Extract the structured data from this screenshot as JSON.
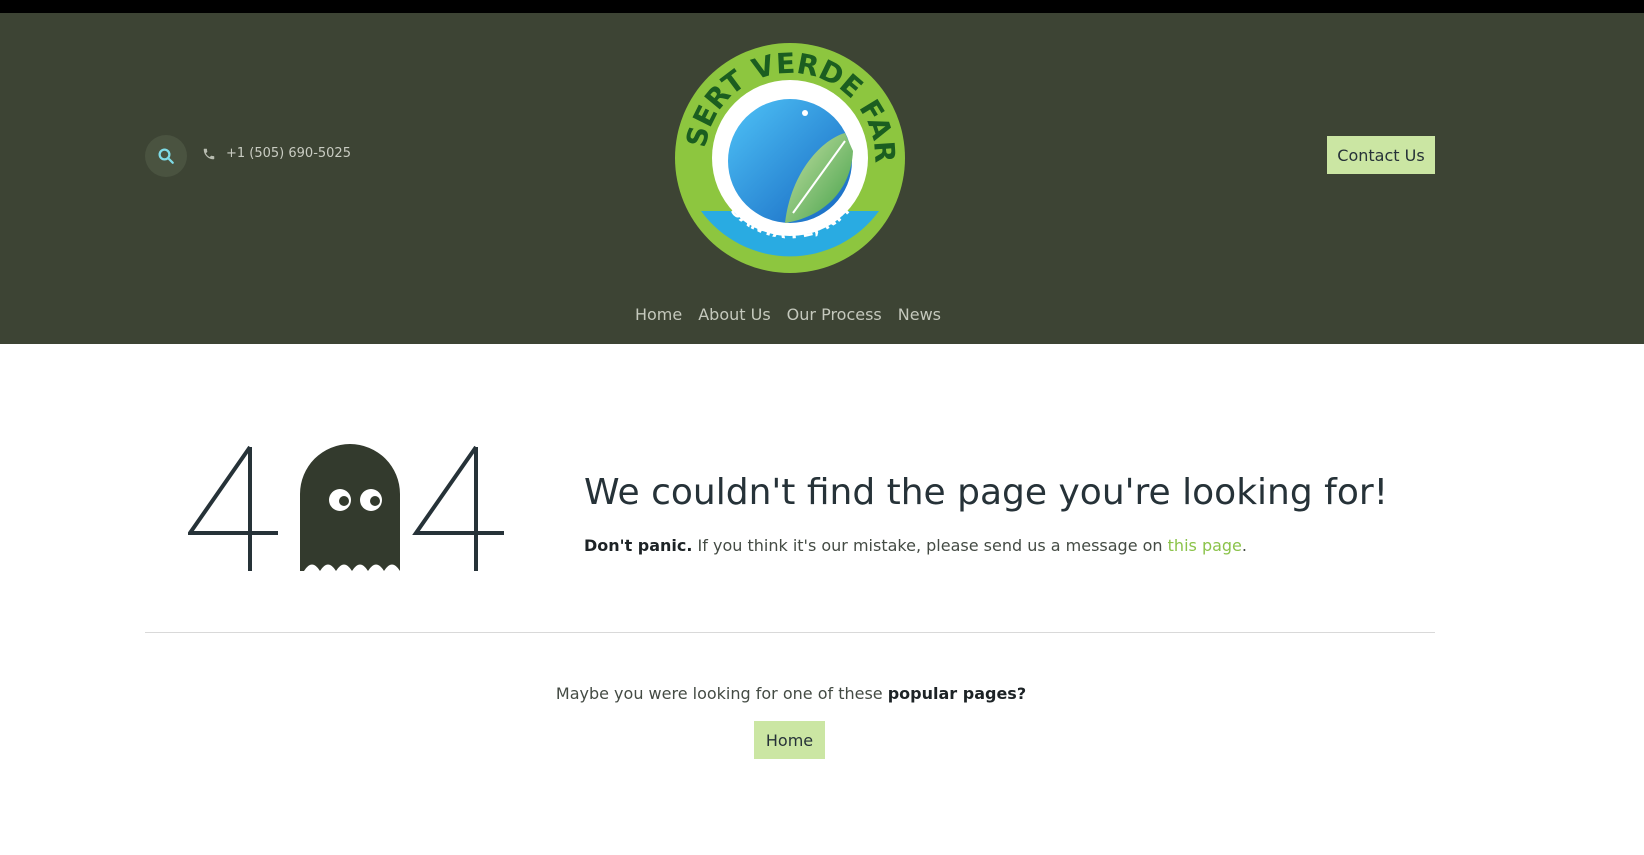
{
  "header": {
    "phone": "+1 (505) 690-5025",
    "contact_label": "Contact Us",
    "logo": {
      "top_text": "DESERT VERDE FARM",
      "bottom_text": "SANTA FE, NM"
    }
  },
  "nav": {
    "items": [
      "Home",
      "About Us",
      "Our Process",
      "News"
    ]
  },
  "error": {
    "code": "404",
    "headline": "We couldn't find the page you're looking for!",
    "bold": "Don't panic.",
    "message": " If you think it's our mistake, please send us a message on ",
    "link": "this page",
    "period": "."
  },
  "popular": {
    "prefix": "Maybe you were looking for one of these ",
    "bold": "popular pages?",
    "button": "Home"
  },
  "colors": {
    "header_bg": "#3d4434",
    "accent_button": "#cbe6a3",
    "link": "#8bc34a",
    "text": "#263238"
  },
  "icons": [
    "search-icon",
    "phone-icon",
    "ghost-icon"
  ]
}
